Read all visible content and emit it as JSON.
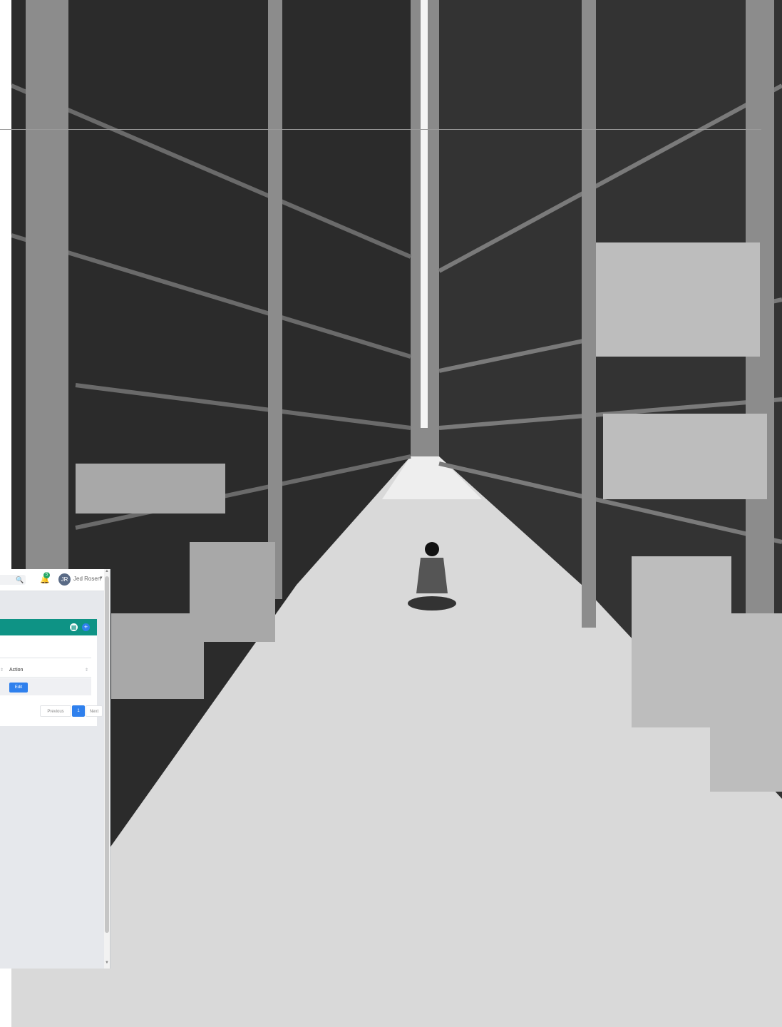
{
  "app": {
    "topbar": {
      "search_icon": "search-icon",
      "notification_count": "5",
      "avatar_initials": "JR",
      "user_name": "Jed Rosen"
    },
    "card": {
      "grid_icon": "grid-icon",
      "add_icon": "plus-icon",
      "column_header": "Action",
      "edit_label": "Edit",
      "pagination": {
        "previous": "Previous",
        "page": "1",
        "next": "Next"
      }
    },
    "colors": {
      "header_teal": "#0e9385",
      "primary_blue": "#2f80ed",
      "badge_green": "#27a866"
    }
  }
}
